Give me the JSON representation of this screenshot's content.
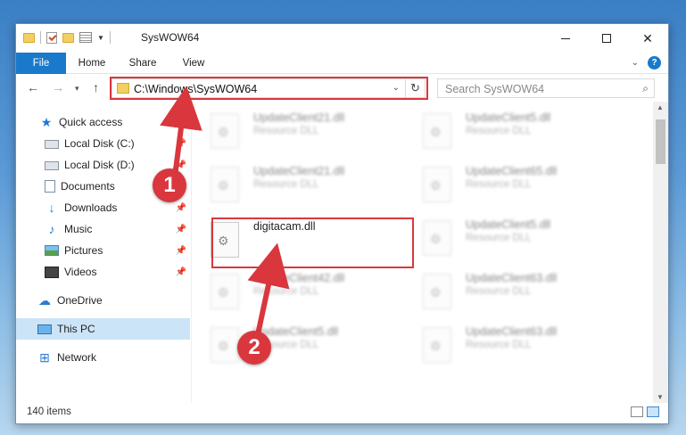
{
  "window": {
    "title": "SysWOW64",
    "controls": {
      "minimize": "—",
      "maximize": "☐",
      "close": "✕"
    }
  },
  "ribbon": {
    "tabs": [
      "File",
      "Home",
      "Share",
      "View"
    ],
    "help": "?"
  },
  "navigation": {
    "address_path": "C:\\Windows\\SysWOW64",
    "search_placeholder": "Search SysWOW64"
  },
  "sidebar": {
    "items": [
      {
        "label": "Quick access",
        "icon": "star-icon"
      },
      {
        "label": "Local Disk (C:)",
        "icon": "disk-icon",
        "pinned": true
      },
      {
        "label": "Local Disk (D:)",
        "icon": "disk-icon",
        "pinned": true
      },
      {
        "label": "Documents",
        "icon": "documents-icon",
        "pinned": true
      },
      {
        "label": "Downloads",
        "icon": "download-icon",
        "pinned": true
      },
      {
        "label": "Music",
        "icon": "music-icon",
        "pinned": true
      },
      {
        "label": "Pictures",
        "icon": "pictures-icon",
        "pinned": true
      },
      {
        "label": "Videos",
        "icon": "videos-icon",
        "pinned": true
      },
      {
        "label": "OneDrive",
        "icon": "cloud-icon"
      },
      {
        "label": "This PC",
        "icon": "pc-icon",
        "selected": true
      },
      {
        "label": "Network",
        "icon": "network-icon"
      }
    ]
  },
  "files": {
    "left": [
      {
        "name": "UpdateClient21.dll",
        "type": "Resource DLL",
        "blurred": true
      },
      {
        "name": "UpdateClient21.dll",
        "type": "Resource DLL",
        "blurred": true
      },
      {
        "name": "digitacam.dll",
        "type": "",
        "blurred": false
      },
      {
        "name": "UpdateClient42.dll",
        "type": "Resource DLL",
        "blurred": true
      },
      {
        "name": "UpdateClient5.dll",
        "type": "Resource DLL",
        "blurred": true
      }
    ],
    "right": [
      {
        "name": "UpdateClient5.dll",
        "type": "Resource DLL",
        "blurred": true
      },
      {
        "name": "UpdateClient65.dll",
        "type": "Resource DLL",
        "blurred": true
      },
      {
        "name": "UpdateClient5.dll",
        "type": "Resource DLL",
        "blurred": true
      },
      {
        "name": "UpdateClient63.dll",
        "type": "Resource DLL",
        "blurred": true
      },
      {
        "name": "UpdateClient63.dll",
        "type": "Resource DLL",
        "blurred": true
      }
    ]
  },
  "status": {
    "item_count": "140 items"
  },
  "annotations": {
    "step1": "1",
    "step2": "2",
    "accent_color": "#d9373d"
  }
}
